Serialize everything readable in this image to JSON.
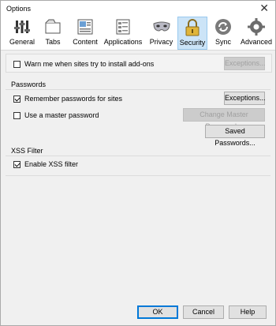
{
  "window": {
    "title": "Options"
  },
  "tabs": [
    {
      "label": "General"
    },
    {
      "label": "Tabs"
    },
    {
      "label": "Content"
    },
    {
      "label": "Applications"
    },
    {
      "label": "Privacy"
    },
    {
      "label": "Security",
      "active": true
    },
    {
      "label": "Sync"
    },
    {
      "label": "Advanced"
    }
  ],
  "addons": {
    "warn_label": "Warn me when sites try to install add-ons",
    "warn_checked": false,
    "exceptions_label": "Exceptions...",
    "exceptions_disabled": true
  },
  "passwords": {
    "section_label": "Passwords",
    "remember_label": "Remember passwords for sites",
    "remember_checked": true,
    "exceptions_label": "Exceptions...",
    "master_label": "Use a master password",
    "master_checked": false,
    "change_master_label": "Change Master Password...",
    "change_master_disabled": true,
    "saved_label": "Saved Passwords..."
  },
  "xss": {
    "section_label": "XSS Filter",
    "enable_label": "Enable XSS filter",
    "enable_checked": true
  },
  "footer": {
    "ok_label": "OK",
    "cancel_label": "Cancel",
    "help_label": "Help"
  }
}
